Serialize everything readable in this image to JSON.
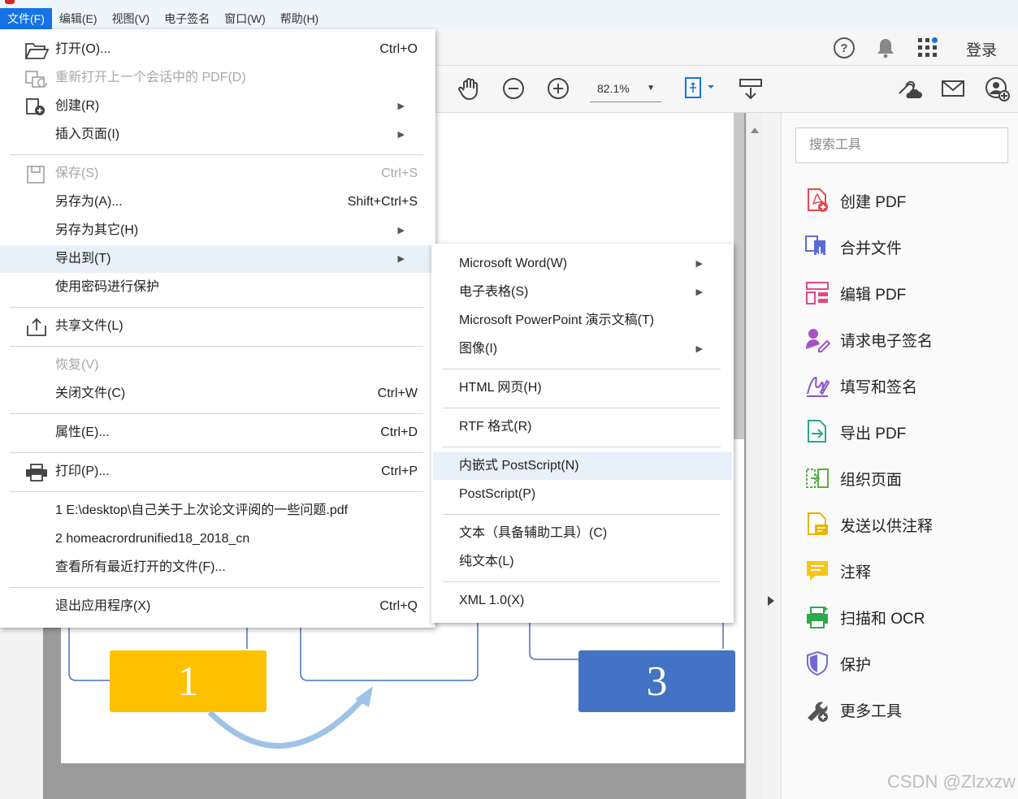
{
  "menubar": {
    "items": [
      "文件(F)",
      "编辑(E)",
      "视图(V)",
      "电子签名",
      "窗口(W)",
      "帮助(H)"
    ]
  },
  "header": {
    "login": "登录",
    "zoom": "82.1%"
  },
  "file_menu": {
    "open": "打开(O)...",
    "open_sc": "Ctrl+O",
    "reopen": "重新打开上一个会话中的 PDF(D)",
    "create": "创建(R)",
    "insert_page": "插入页面(I)",
    "save": "保存(S)",
    "save_sc": "Ctrl+S",
    "save_as": "另存为(A)...",
    "save_as_sc": "Shift+Ctrl+S",
    "save_other": "另存为其它(H)",
    "export_to": "导出到(T)",
    "password_protect": "使用密码进行保护",
    "share": "共享文件(L)",
    "revert": "恢复(V)",
    "close": "关闭文件(C)",
    "close_sc": "Ctrl+W",
    "properties": "属性(E)...",
    "properties_sc": "Ctrl+D",
    "print": "打印(P)...",
    "print_sc": "Ctrl+P",
    "recent1": "1 E:\\desktop\\自己关于上次论文评阅的一些问题.pdf",
    "recent2": "2 homeacrordrunified18_2018_cn",
    "view_all_recent": "查看所有最近打开的文件(F)...",
    "exit": "退出应用程序(X)",
    "exit_sc": "Ctrl+Q"
  },
  "export_menu": {
    "word": "Microsoft Word(W)",
    "spreadsheet": "电子表格(S)",
    "powerpoint": "Microsoft PowerPoint 演示文稿(T)",
    "image": "图像(I)",
    "html": "HTML 网页(H)",
    "rtf": "RTF 格式(R)",
    "eps": "内嵌式 PostScript(N)",
    "postscript": "PostScript(P)",
    "text_accessible": "文本（具备辅助工具）(C)",
    "plain_text": "纯文本(L)",
    "xml": "XML 1.0(X)"
  },
  "tools_pane": {
    "search_placeholder": "搜索工具",
    "items": [
      "创建 PDF",
      "合并文件",
      "编辑 PDF",
      "请求电子签名",
      "填写和签名",
      "导出 PDF",
      "组织页面",
      "发送以供注释",
      "注释",
      "扫描和 OCR",
      "保护",
      "更多工具"
    ]
  },
  "document": {
    "box1_label": "1",
    "box3_label": "3",
    "box1_color": "#ffc000",
    "box3_color": "#4472c4"
  },
  "watermark": "CSDN @Zlzxzw"
}
